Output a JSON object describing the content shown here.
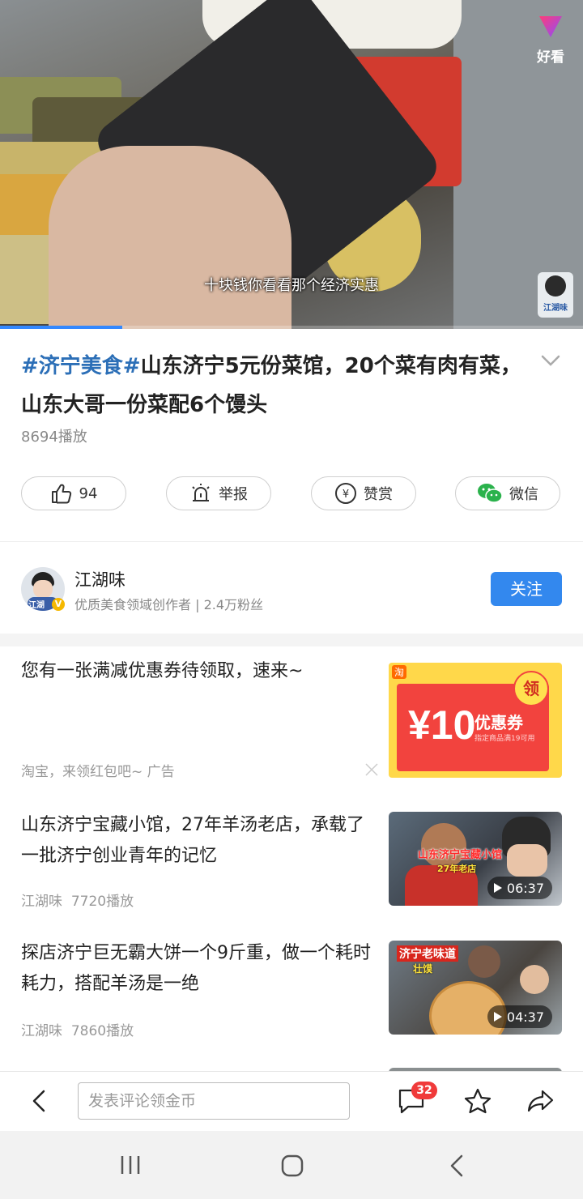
{
  "video": {
    "brand_logo_text": "好看",
    "subtitle": "十块钱你看看那个经济实惠",
    "watermark_text": "江湖味",
    "progress_fraction": 0.21
  },
  "post": {
    "hashtag": "#济宁美食#",
    "title": "山东济宁5元份菜馆，20个菜有肉有菜，山东大哥一份菜配6个馒头",
    "plays": "8694播放"
  },
  "actions": {
    "like_count": "94",
    "report_label": "举报",
    "reward_label": "赞赏",
    "wechat_label": "微信"
  },
  "author": {
    "name": "江湖味",
    "description": "优质美食领域创作者 | 2.4万粉丝",
    "follow_label": "关注",
    "avatar_text": "江湖"
  },
  "feed": {
    "ad": {
      "title": "您有一张满减优惠券待领取，速来~",
      "meta": "淘宝，来领红包吧~  广告",
      "coupon_amount": "¥10",
      "coupon_label": "优惠券",
      "coupon_sub": "指定商品满19可用",
      "claim_label": "领",
      "brand_mark": "淘"
    },
    "items": [
      {
        "title": "山东济宁宝藏小馆，27年羊汤老店，承载了一批济宁创业青年的记忆",
        "author": "江湖味",
        "plays": "7720播放",
        "duration": "06:37",
        "thumb_text": "山东济宁宝藏小馆",
        "thumb_sub": "27年老店"
      },
      {
        "title": "探店济宁巨无霸大饼一个9斤重，做一个耗时耗力，搭配羊汤是一绝",
        "author": "江湖味",
        "plays": "7860播放",
        "duration": "04:37",
        "thumb_text": "济宁老味道",
        "thumb_sub": "壮馍"
      }
    ]
  },
  "bottom_bar": {
    "comment_placeholder": "发表评论领金币",
    "comment_count": "32"
  },
  "icons": {
    "back": "chevron-left-icon",
    "comment": "comment-icon",
    "favorite": "star-icon",
    "share": "share-icon"
  },
  "colors": {
    "accent_blue": "#3388ee",
    "hashtag_blue": "#2c6fb7",
    "badge_red": "#f03a3a"
  }
}
